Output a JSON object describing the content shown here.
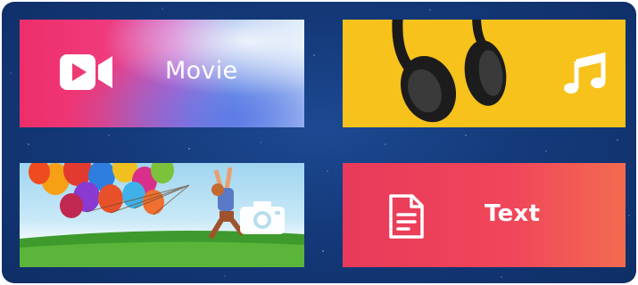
{
  "tiles": {
    "movie": {
      "label": "Movie",
      "icon": "video-camera-icon"
    },
    "music": {
      "label": "",
      "icon": "music-notes-icon"
    },
    "photo": {
      "label": "",
      "icon": "camera-icon"
    },
    "text": {
      "label": "Text",
      "icon": "document-icon"
    }
  },
  "colors": {
    "background": "#143a7a",
    "music_yellow": "#f7c21b",
    "text_red": "#ee4058",
    "movie_pink": "#ee2e6a"
  }
}
